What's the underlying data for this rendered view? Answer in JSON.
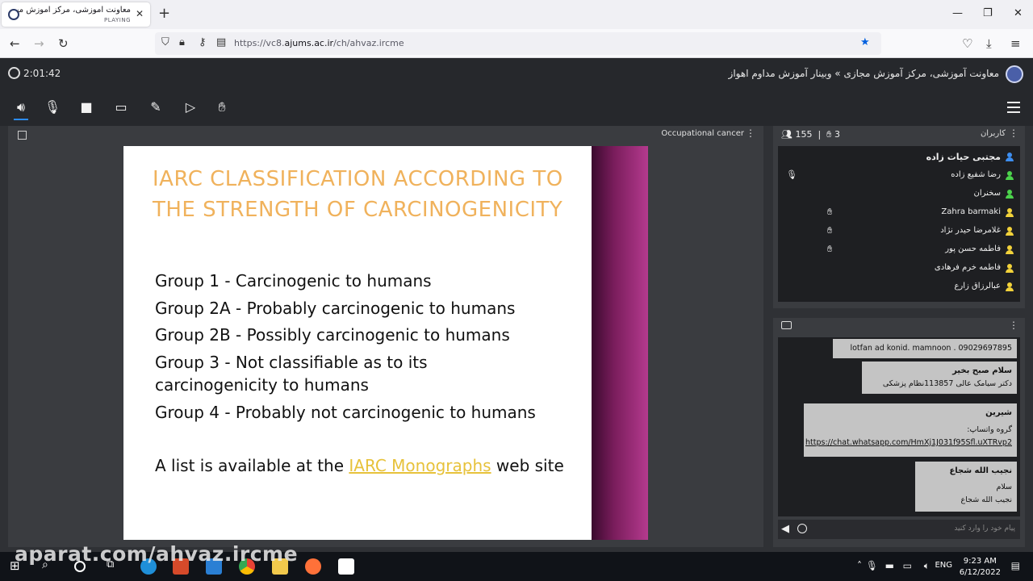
{
  "browser": {
    "tab_title": "معاونت آموزشی، مرکز آموزش مجازی",
    "tab_status": "PLAYING",
    "url_prefix": "https://vc8.",
    "url_domain": "ajums.ac.ir",
    "url_path": "/ch/ahvaz.ircme"
  },
  "header": {
    "timer": "2:01:42",
    "breadcrumb": "معاونت آموزشی، مرکز آموزش مجازی » وبینار آموزش مداوم اهواز"
  },
  "stage": {
    "title": "Occupational cancer",
    "slide": {
      "heading_line1": "IARC CLASSIFICATION ACCORDING TO",
      "heading_line2": "THE STRENGTH OF CARCINOGENICITY",
      "items": [
        "Group 1 - Carcinogenic to humans",
        "Group 2A - Probably carcinogenic to humans",
        "Group 2B - Possibly carcinogenic to humans",
        "Group 3 - Not classifiable as to its carcinogenicity to humans",
        "Group 4 - Probably not carcinogenic to humans"
      ],
      "footer_pre": "A list is available at the ",
      "footer_link": "IARC Monographs",
      "footer_post": " web site"
    }
  },
  "users": {
    "title": "کاربران",
    "count": "155",
    "raised_count": "3",
    "list": [
      {
        "name": "مجتبی حیات زاده",
        "color": "#3d8ef0"
      },
      {
        "name": "رضا شفیع زاده",
        "color": "#4cd34c"
      },
      {
        "name": "سخنران",
        "color": "#4cd34c"
      },
      {
        "name": "Zahra barmaki",
        "color": "#f2d23a"
      },
      {
        "name": "غلامرضا حیدر نژاد",
        "color": "#f2d23a"
      },
      {
        "name": "فاطمه حسن پور",
        "color": "#f2d23a"
      },
      {
        "name": "فاطمه خرم فرهادی",
        "color": "#f2d23a"
      },
      {
        "name": "عبالرزاق زارع",
        "color": "#f2d23a"
      }
    ]
  },
  "chat": {
    "messages": [
      {
        "text": "lotfan ad konid. mamnoon . 09029697895"
      },
      {
        "sender": "سلام صبح بخیر",
        "text": "دکتر سیامک عالی 113857نظام پزشکی"
      },
      {
        "sender": "شیرین",
        "prefix": "گروه واتساپ: ",
        "link": "https://chat.whatsapp.com/HmXj1J031f95Sfl.uXTRvp2"
      },
      {
        "sender": "نجیب الله شجاع",
        "line1": "سلام",
        "line2": "نجیب الله شجاع"
      }
    ],
    "placeholder": "پیام خود را وارد کنید"
  },
  "taskbar": {
    "watermark": "aparat.com/ahvaz.ircme",
    "lang": "ENG",
    "time": "9:23 AM",
    "date": "6/12/2022"
  }
}
